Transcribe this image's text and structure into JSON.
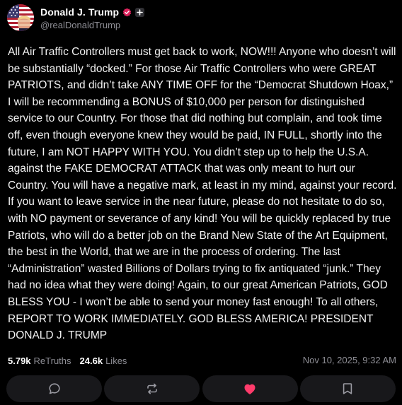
{
  "author": {
    "display_name": "Donald J. Trump",
    "handle": "@realDonaldTrump",
    "avatar_icon": "profile-avatar-flag",
    "verified_icon": "verified-badge-icon",
    "verified_color": "#e0245e",
    "plus_icon": "plus-badge-icon"
  },
  "post": {
    "text": "All Air Traffic Controllers must get back to work, NOW!!! Anyone who doesn’t will be substantially “docked.” For those Air Traffic Controllers who were GREAT PATRIOTS, and didn’t take ANY TIME OFF for the “Democrat Shutdown Hoax,” I will be recommending a BONUS of $10,000 per person for distinguished service to our Country. For those that did nothing but complain, and took time off, even though everyone knew they would be paid, IN FULL, shortly into the future, I am NOT HAPPY WITH YOU. You didn’t step up to help the U.S.A. against the FAKE DEMOCRAT ATTACK that was only meant to hurt our Country. You will have a negative mark, at least in my mind, against your record. If you want to leave service in the near future, please do not hesitate to do so, with NO payment or severance of any kind! You will be quickly replaced by true Patriots, who will do a better job on the Brand New State of the Art Equipment, the best in the World, that we are in the process of ordering. The last “Administration” wasted Billions of Dollars trying to fix antiquated “junk.” They had no idea what they were doing! Again, to our great American Patriots, GOD BLESS YOU - I won’t be able to send your money fast enough! To all others, REPORT TO WORK IMMEDIATELY. GOD BLESS AMERICA! PRESIDENT DONALD J. TRUMP"
  },
  "stats": {
    "retruths_count": "5.79k",
    "retruths_label": "ReTruths",
    "likes_count": "24.6k",
    "likes_label": "Likes"
  },
  "timestamp": "Nov 10, 2025, 9:32 AM",
  "actions": [
    {
      "icon": "reply-icon"
    },
    {
      "icon": "retruth-icon"
    },
    {
      "icon": "like-heart-icon",
      "color": "#ff3b6b"
    },
    {
      "icon": "bookmark-icon"
    }
  ],
  "colors": {
    "background": "#000000",
    "text": "#f2f2f2",
    "muted": "#8e8e95",
    "button_bg": "#18181b",
    "icon": "#9a9aa2"
  }
}
